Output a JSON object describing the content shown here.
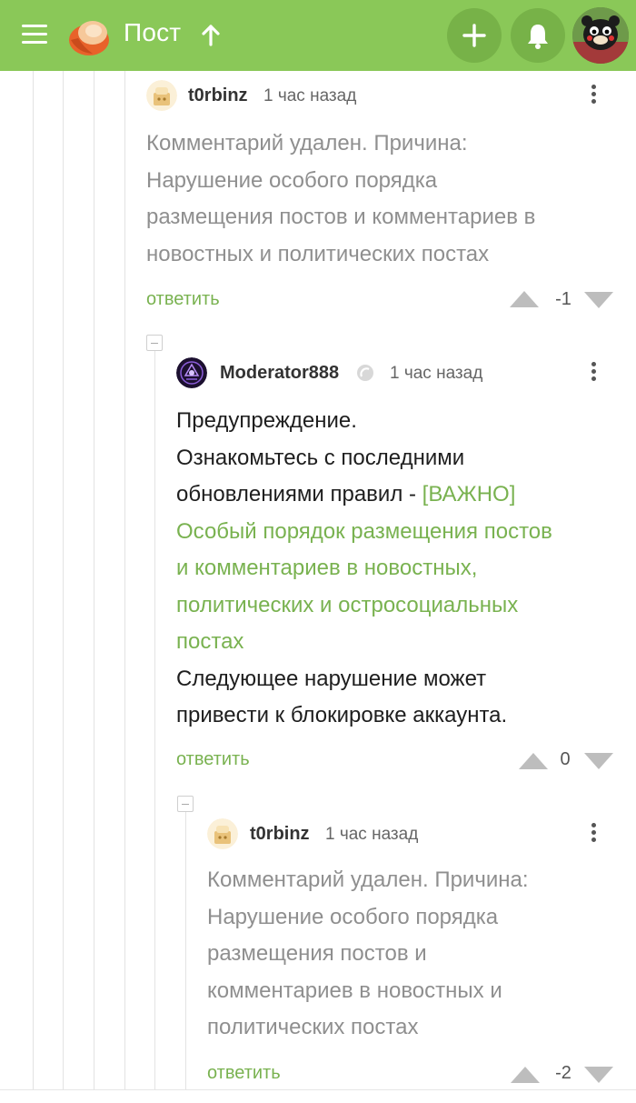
{
  "header": {
    "title": "Пост",
    "menu_icon": "hamburger-menu-icon",
    "logo_icon": "pikabu-logo-icon",
    "up_icon": "arrow-up-icon",
    "add_icon": "plus-icon",
    "bell_icon": "bell-icon",
    "colors": {
      "bar": "#8ac858",
      "button": "#77b248"
    }
  },
  "comments": [
    {
      "author": "t0rbinz",
      "time": "1 час назад",
      "body": "Комментарий удален. Причина:\nНарушение особого порядка\nразмещения постов и комментариев в\nновостных и политических постах",
      "reply_label": "ответить",
      "rating": "-1"
    },
    {
      "author": "Moderator888",
      "time": "1 час назад",
      "body_before": "Предупреждение.\nОзнакомьтесь с последними\nобновлениями правил - ",
      "link_text": "[ВАЖНО]\nОсобый порядок размещения постов\nи комментариев в новостных,\nполитических и остросоциальных\nпостах",
      "body_after": "\nСледующее нарушение может\nпривести к блокировке аккаунта.",
      "reply_label": "ответить",
      "rating": "0"
    },
    {
      "author": "t0rbinz",
      "time": "1 час назад",
      "body": "Комментарий удален. Причина:\nНарушение особого порядка\nразмещения постов и\nкомментариев в новостных и\nполитических постах",
      "reply_label": "ответить",
      "rating": "-2"
    }
  ]
}
